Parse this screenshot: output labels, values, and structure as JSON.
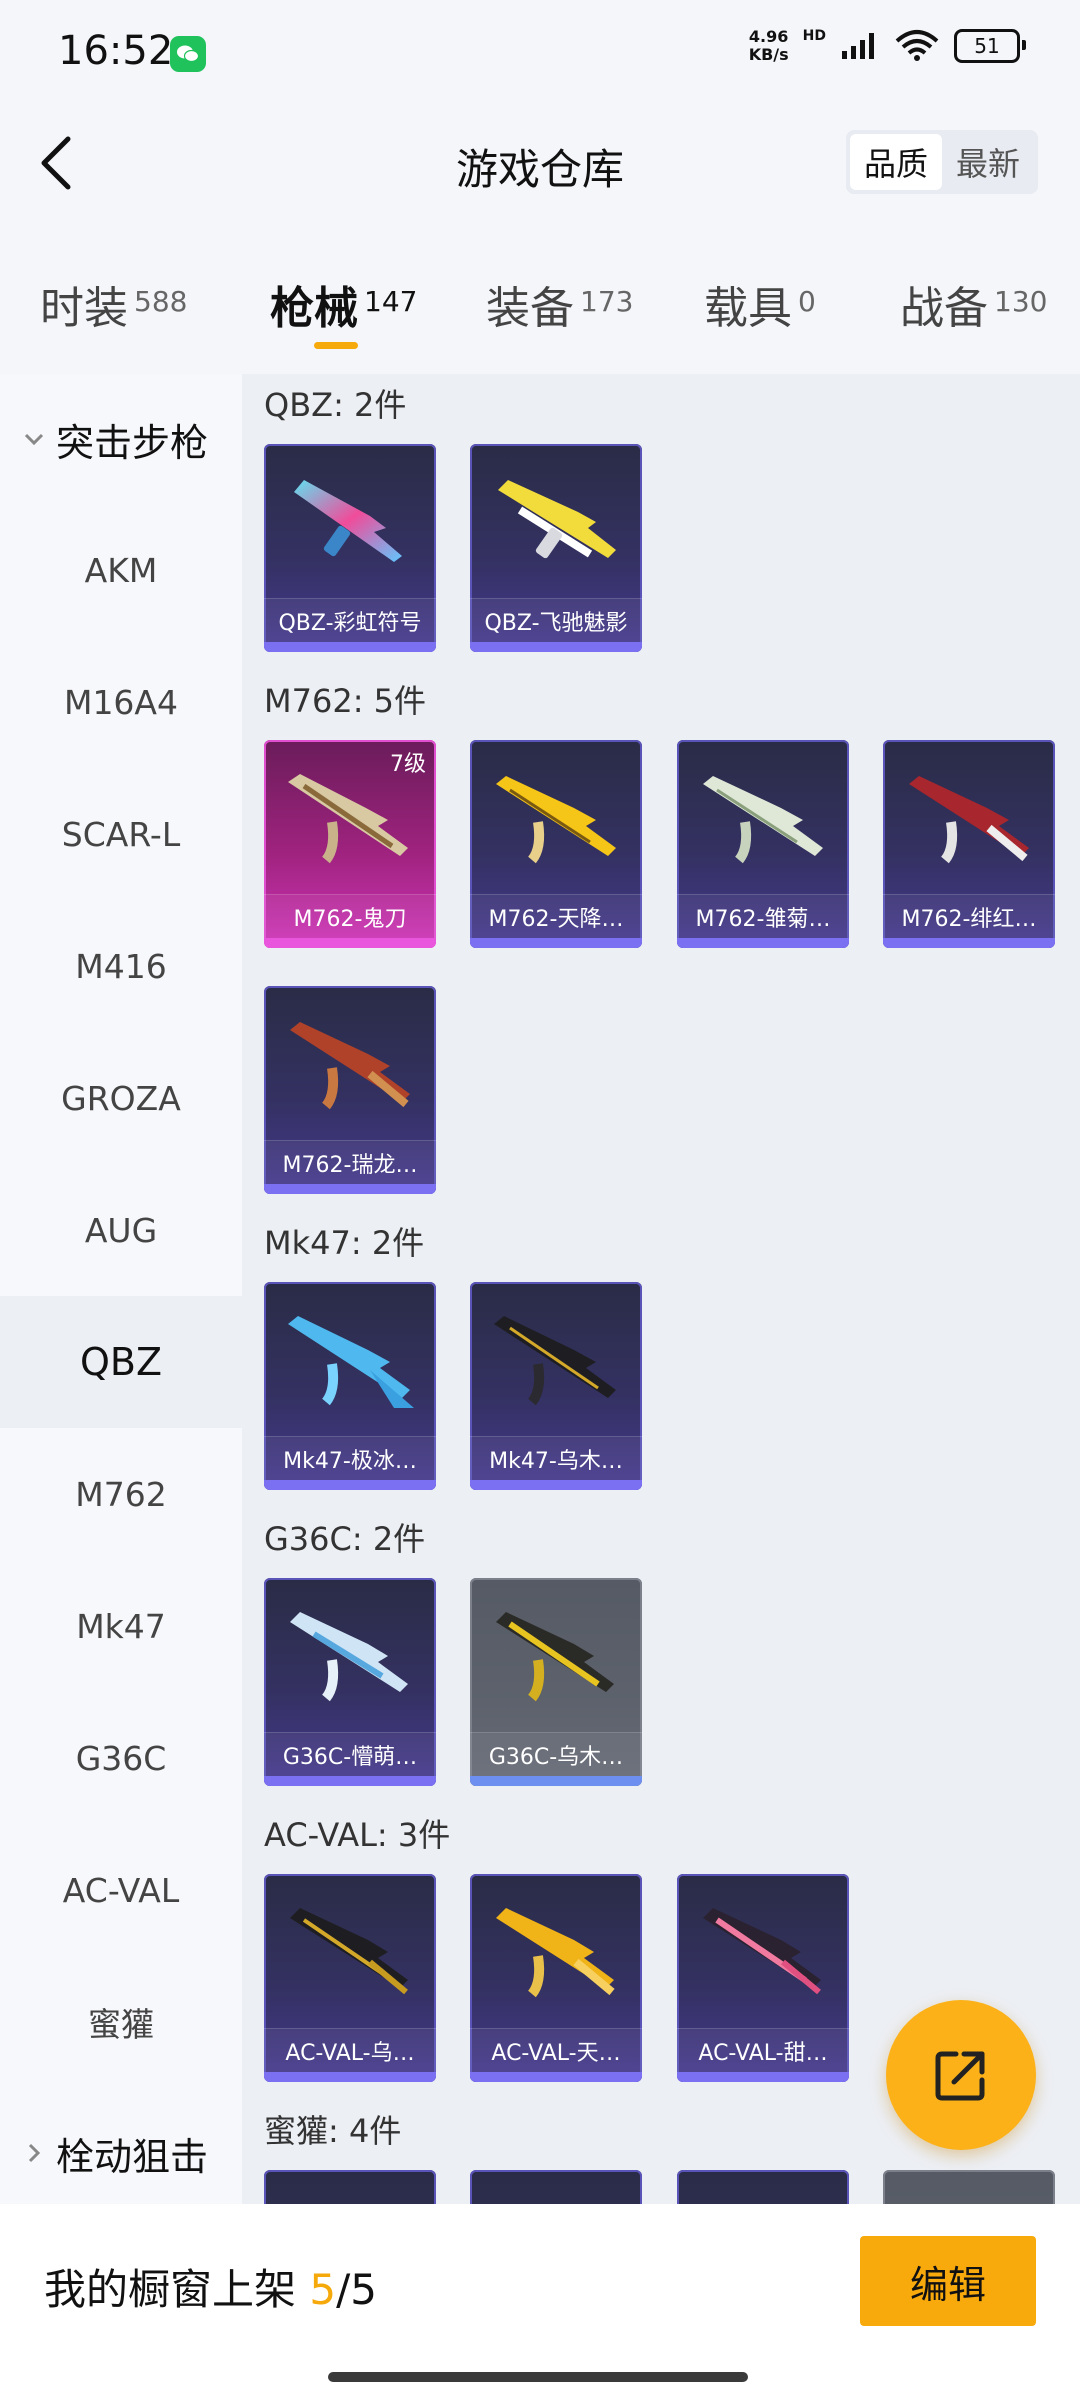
{
  "status": {
    "time": "16:52",
    "net_speed_value": "4.96",
    "net_speed_unit": "KB/s",
    "hd": "HD",
    "battery": "51"
  },
  "header": {
    "title": "游戏仓库",
    "sort_quality": "品质",
    "sort_newest": "最新"
  },
  "tabs": [
    {
      "label": "时装",
      "count": "588"
    },
    {
      "label": "枪械",
      "count": "147"
    },
    {
      "label": "装备",
      "count": "173"
    },
    {
      "label": "载具",
      "count": "0"
    },
    {
      "label": "战备",
      "count": "130"
    }
  ],
  "sidebar": {
    "category_open": "突击步枪",
    "items": [
      "AKM",
      "M16A4",
      "SCAR-L",
      "M416",
      "GROZA",
      "AUG",
      "QBZ",
      "M762",
      "Mk47",
      "G36C",
      "AC-VAL",
      "蜜獾"
    ],
    "category_closed": "栓动狙击"
  },
  "groups": [
    {
      "title": "QBZ: 2件",
      "items": [
        {
          "name": "QBZ-彩虹符号"
        },
        {
          "name": "QBZ-飞驰魅影"
        }
      ]
    },
    {
      "title": "M762: 5件",
      "items": [
        {
          "name": "M762-鬼刀",
          "level": "7级"
        },
        {
          "name": "M762-天降…"
        },
        {
          "name": "M762-雏菊…"
        },
        {
          "name": "M762-绯红…"
        },
        {
          "name": "M762-瑞龙…"
        }
      ]
    },
    {
      "title": "Mk47: 2件",
      "items": [
        {
          "name": "Mk47-极冰…"
        },
        {
          "name": "Mk47-乌木…"
        }
      ]
    },
    {
      "title": "G36C: 2件",
      "items": [
        {
          "name": "G36C-懵萌…"
        },
        {
          "name": "G36C-乌木…"
        }
      ]
    },
    {
      "title": "AC-VAL: 3件",
      "items": [
        {
          "name": "AC-VAL-乌…"
        },
        {
          "name": "AC-VAL-天…"
        },
        {
          "name": "AC-VAL-甜…"
        }
      ]
    },
    {
      "title": "蜜獾: 4件"
    }
  ],
  "bottom": {
    "showcase_label": "我的橱窗上架 ",
    "showcase_current": "5",
    "showcase_total": "/5",
    "edit": "编辑"
  },
  "colors": {
    "accent": "#f6a90a",
    "card_purple": "#463a90",
    "card_pink": "#cf35b9",
    "card_gray": "#666b76"
  }
}
